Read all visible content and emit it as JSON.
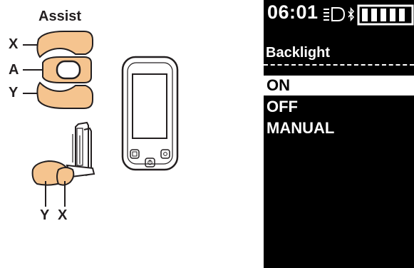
{
  "diagram": {
    "heading": "Assist",
    "switch_labels": {
      "x": "X",
      "a": "A",
      "y": "Y"
    },
    "lever_labels": {
      "y": "Y",
      "x": "X"
    },
    "colors": {
      "switch_fill": "#f5c48f",
      "outline": "#231f20"
    }
  },
  "display": {
    "time": "06:01",
    "status_icons": [
      "headlight-icon",
      "bluetooth-icon",
      "battery-icon"
    ],
    "battery_bars": 5,
    "title": "Backlight",
    "menu": [
      {
        "label": "ON",
        "selected": true
      },
      {
        "label": "OFF",
        "selected": false
      },
      {
        "label": "MANUAL",
        "selected": false
      }
    ]
  }
}
